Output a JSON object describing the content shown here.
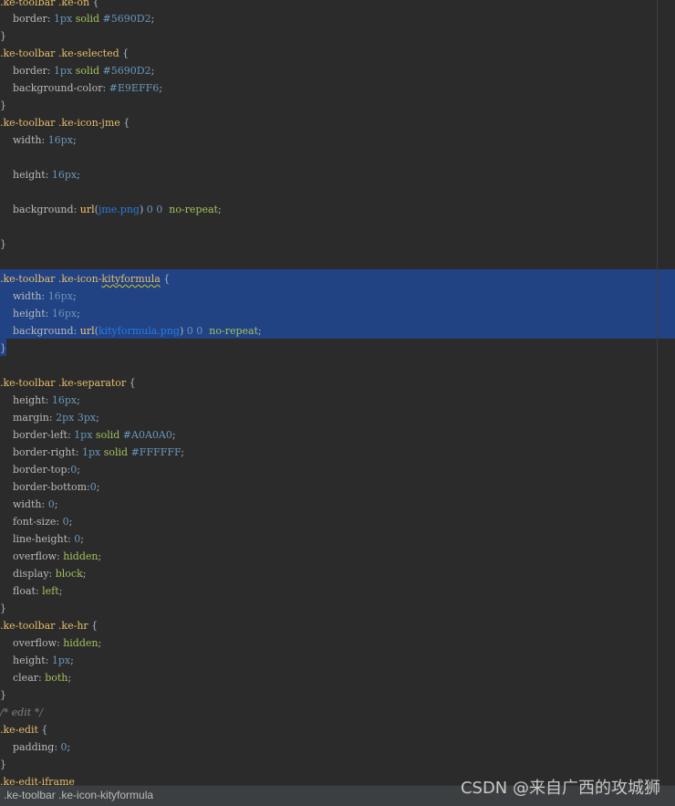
{
  "status_bar": {
    "breadcrumb": ".ke-toolbar .ke-icon-kityformula"
  },
  "watermark": "CSDN @来自广西的攻城狮",
  "colors": {
    "background": "#2b2b2b",
    "selection": "#214283",
    "selector": "#e8bf6a",
    "property": "#bababa",
    "number": "#6897bb",
    "keyword_value": "#a5c25c",
    "url": "#287bde",
    "comment": "#808080"
  },
  "code": {
    "l01": {
      "sel": ".ke-toolbar .ke-on",
      "p": " {"
    },
    "l02": {
      "prop": "border",
      "v1": "1px",
      "v2": "solid",
      "v3": "#5690D2"
    },
    "l03": "}",
    "l04": {
      "sel": ".ke-toolbar .ke-selected",
      "p": " {"
    },
    "l05": {
      "prop": "border",
      "v1": "1px",
      "v2": "solid",
      "v3": "#5690D2"
    },
    "l06": {
      "prop": "background-color",
      "v1": "#E9EFF6"
    },
    "l07": "}",
    "l08": {
      "sel": ".ke-toolbar .ke-icon-jme",
      "p": " {"
    },
    "l09": {
      "prop": "width",
      "v1": "16px"
    },
    "l10": {
      "prop": "height",
      "v1": "16px"
    },
    "l11": {
      "prop": "background",
      "fn": "url",
      "arg": "jme.png",
      "n1": "0",
      "n2": "0",
      "v": "no-repeat"
    },
    "l12": "}",
    "l13": {
      "sel_a": ".ke-toolbar .ke-icon-",
      "sel_b": "kityformula",
      "p": " {"
    },
    "l14": {
      "prop": "width",
      "v1": "16px"
    },
    "l15": {
      "prop": "height",
      "v1": "16px"
    },
    "l16": {
      "prop": "background",
      "fn": "url",
      "arg": "kityformula.png",
      "n1": "0",
      "n2": "0",
      "v": "no-repeat"
    },
    "l17": "}",
    "l18": {
      "sel": ".ke-toolbar .ke-separator",
      "p": " {"
    },
    "l19": {
      "prop": "height",
      "v1": "16px"
    },
    "l20": {
      "prop": "margin",
      "v1": "2px",
      "v2": "3px"
    },
    "l21": {
      "prop": "border-left",
      "v1": "1px",
      "v2": "solid",
      "v3": "#A0A0A0"
    },
    "l22": {
      "prop": "border-right",
      "v1": "1px",
      "v2": "solid",
      "v3": "#FFFFFF"
    },
    "l23": {
      "prop": "border-top",
      "v1": "0"
    },
    "l24": {
      "prop": "border-bottom",
      "v1": "0"
    },
    "l25": {
      "prop": "width",
      "v1": "0"
    },
    "l26": {
      "prop": "font-size",
      "v1": "0"
    },
    "l27": {
      "prop": "line-height",
      "v1": "0"
    },
    "l28": {
      "prop": "overflow",
      "v1": "hidden"
    },
    "l29": {
      "prop": "display",
      "v1": "block"
    },
    "l30": {
      "prop": "float",
      "v1": "left"
    },
    "l31": "}",
    "l32": {
      "sel": ".ke-toolbar .ke-hr",
      "p": " {"
    },
    "l33": {
      "prop": "overflow",
      "v1": "hidden"
    },
    "l34": {
      "prop": "height",
      "v1": "1px"
    },
    "l35": {
      "prop": "clear",
      "v1": "both"
    },
    "l36": "}",
    "l37": "/* edit */",
    "l38": {
      "sel": ".ke-edit",
      "p": " {"
    },
    "l39": {
      "prop": "padding",
      "v1": "0"
    },
    "l40": "}",
    "l41": {
      "sel": ".ke-edit-iframe"
    }
  }
}
